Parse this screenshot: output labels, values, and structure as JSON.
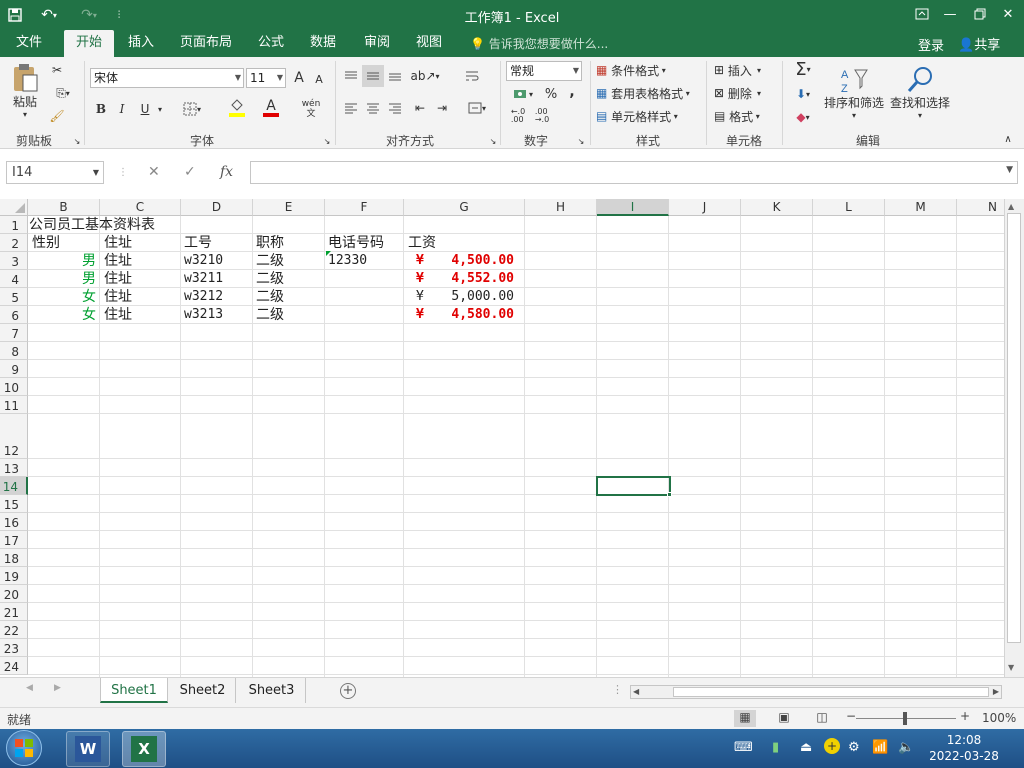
{
  "window": {
    "title": "工作簿1 - Excel"
  },
  "ribbon_tabs": [
    {
      "label": "文件"
    },
    {
      "label": "开始"
    },
    {
      "label": "插入"
    },
    {
      "label": "页面布局"
    },
    {
      "label": "公式"
    },
    {
      "label": "数据"
    },
    {
      "label": "审阅"
    },
    {
      "label": "视图"
    }
  ],
  "tell_me": "告诉我您想要做什么...",
  "account": {
    "login": "登录",
    "share": "共享"
  },
  "clipboard": {
    "paste": "粘贴",
    "group": "剪贴板"
  },
  "font": {
    "name": "宋体",
    "size": "11",
    "group": "字体",
    "bold": "B",
    "italic": "I",
    "underline": "U",
    "grow": "A",
    "shrink": "A",
    "color_a": "A",
    "wen": "wén 文"
  },
  "alignment": {
    "group": "对齐方式"
  },
  "number": {
    "format": "常规",
    "group": "数字",
    "percent": "%",
    "comma": ","
  },
  "styles": {
    "cond": "条件格式",
    "table": "套用表格格式",
    "cell": "单元格样式",
    "group": "样式"
  },
  "cells": {
    "insert": "插入",
    "delete": "删除",
    "format": "格式",
    "group": "单元格"
  },
  "editing": {
    "sort": "排序和筛选",
    "find": "查找和选择",
    "group": "编辑"
  },
  "formula_bar": {
    "name_box": "I14",
    "fx": "fx",
    "content": ""
  },
  "columns": [
    "B",
    "C",
    "D",
    "E",
    "F",
    "G",
    "H",
    "I",
    "J",
    "K",
    "L",
    "M",
    "N"
  ],
  "rows": [
    "1",
    "2",
    "3",
    "4",
    "5",
    "6",
    "7",
    "8",
    "9",
    "10",
    "11",
    "12",
    "13",
    "14",
    "15",
    "16",
    "17",
    "18",
    "19",
    "20",
    "21",
    "22",
    "23",
    "24"
  ],
  "sheet": {
    "title": "公司员工基本资料表",
    "headers": {
      "B": "性别",
      "C": "住址",
      "D": "工号",
      "E": "职称",
      "F": "电话号码",
      "G": "工资"
    },
    "records": [
      {
        "gender": "男",
        "address": "住址",
        "id": "w3210",
        "rank": "二级",
        "phone": "12330",
        "salary_symbol": "¥",
        "salary": "4,500.00"
      },
      {
        "gender": "男",
        "address": "住址",
        "id": "w3211",
        "rank": "二级",
        "phone": "",
        "salary_symbol": "¥",
        "salary": "4,552.00"
      },
      {
        "gender": "女",
        "address": "住址",
        "id": "w3212",
        "rank": "二级",
        "phone": "",
        "salary_symbol": "¥",
        "salary": "5,000.00"
      },
      {
        "gender": "女",
        "address": "住址",
        "id": "w3213",
        "rank": "二级",
        "phone": "",
        "salary_symbol": "¥",
        "salary": "4,580.00"
      }
    ]
  },
  "sheet_tabs": [
    {
      "label": "Sheet1"
    },
    {
      "label": "Sheet2"
    },
    {
      "label": "Sheet3"
    }
  ],
  "status": {
    "ready": "就绪",
    "zoom": "100%"
  },
  "taskbar": {
    "time": "12:08",
    "date": "2022-03-28"
  },
  "colors": {
    "accent": "#217346",
    "salary_red": "#e00000",
    "gender_green": "#00a030"
  }
}
